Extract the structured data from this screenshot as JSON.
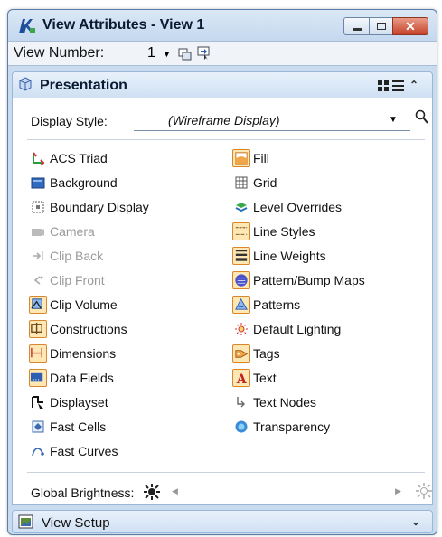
{
  "window": {
    "title": "View Attributes - View 1",
    "close_glyph": "✕"
  },
  "view_number": {
    "label": "View Number:",
    "value": "1"
  },
  "presentation": {
    "title": "Presentation",
    "display_style_label": "Display Style:",
    "display_style_value": "(Wireframe Display)",
    "left_column": [
      {
        "label": "ACS Triad",
        "icon": "acs-triad-icon",
        "enabled": true,
        "checked": false
      },
      {
        "label": "Background",
        "icon": "background-icon",
        "enabled": true,
        "checked": false
      },
      {
        "label": "Boundary Display",
        "icon": "boundary-display-icon",
        "enabled": true,
        "checked": false
      },
      {
        "label": "Camera",
        "icon": "camera-icon",
        "enabled": false,
        "checked": false
      },
      {
        "label": "Clip Back",
        "icon": "clip-back-icon",
        "enabled": false,
        "checked": false
      },
      {
        "label": "Clip Front",
        "icon": "clip-front-icon",
        "enabled": false,
        "checked": false
      },
      {
        "label": "Clip Volume",
        "icon": "clip-volume-icon",
        "enabled": true,
        "checked": true
      },
      {
        "label": "Constructions",
        "icon": "constructions-icon",
        "enabled": true,
        "checked": true
      },
      {
        "label": "Dimensions",
        "icon": "dimensions-icon",
        "enabled": true,
        "checked": true
      },
      {
        "label": "Data Fields",
        "icon": "data-fields-icon",
        "enabled": true,
        "checked": true
      },
      {
        "label": "Displayset",
        "icon": "displayset-icon",
        "enabled": true,
        "checked": false
      },
      {
        "label": "Fast Cells",
        "icon": "fast-cells-icon",
        "enabled": true,
        "checked": false
      },
      {
        "label": "Fast Curves",
        "icon": "fast-curves-icon",
        "enabled": true,
        "checked": false
      }
    ],
    "right_column": [
      {
        "label": "Fill",
        "icon": "fill-icon",
        "enabled": true,
        "checked": true
      },
      {
        "label": "Grid",
        "icon": "grid-icon",
        "enabled": true,
        "checked": false
      },
      {
        "label": "Level Overrides",
        "icon": "level-overrides-icon",
        "enabled": true,
        "checked": false
      },
      {
        "label": "Line Styles",
        "icon": "line-styles-icon",
        "enabled": true,
        "checked": true
      },
      {
        "label": "Line Weights",
        "icon": "line-weights-icon",
        "enabled": true,
        "checked": true
      },
      {
        "label": "Pattern/Bump Maps",
        "icon": "pattern-bump-maps-icon",
        "enabled": true,
        "checked": true
      },
      {
        "label": "Patterns",
        "icon": "patterns-icon",
        "enabled": true,
        "checked": true
      },
      {
        "label": "Default Lighting",
        "icon": "default-lighting-icon",
        "enabled": true,
        "checked": false
      },
      {
        "label": "Tags",
        "icon": "tags-icon",
        "enabled": true,
        "checked": true
      },
      {
        "label": "Text",
        "icon": "text-icon",
        "enabled": true,
        "checked": true
      },
      {
        "label": "Text Nodes",
        "icon": "text-nodes-icon",
        "enabled": true,
        "checked": false
      },
      {
        "label": "Transparency",
        "icon": "transparency-icon",
        "enabled": true,
        "checked": false
      }
    ],
    "global_brightness_label": "Global Brightness:"
  },
  "view_setup": {
    "title": "View Setup"
  },
  "colors": {
    "toggle_on_border": "#d9862c",
    "toggle_on_fill": "#fde7b5",
    "disabled_text": "#9a9a9a",
    "panel_header": "#cfe0f3"
  }
}
